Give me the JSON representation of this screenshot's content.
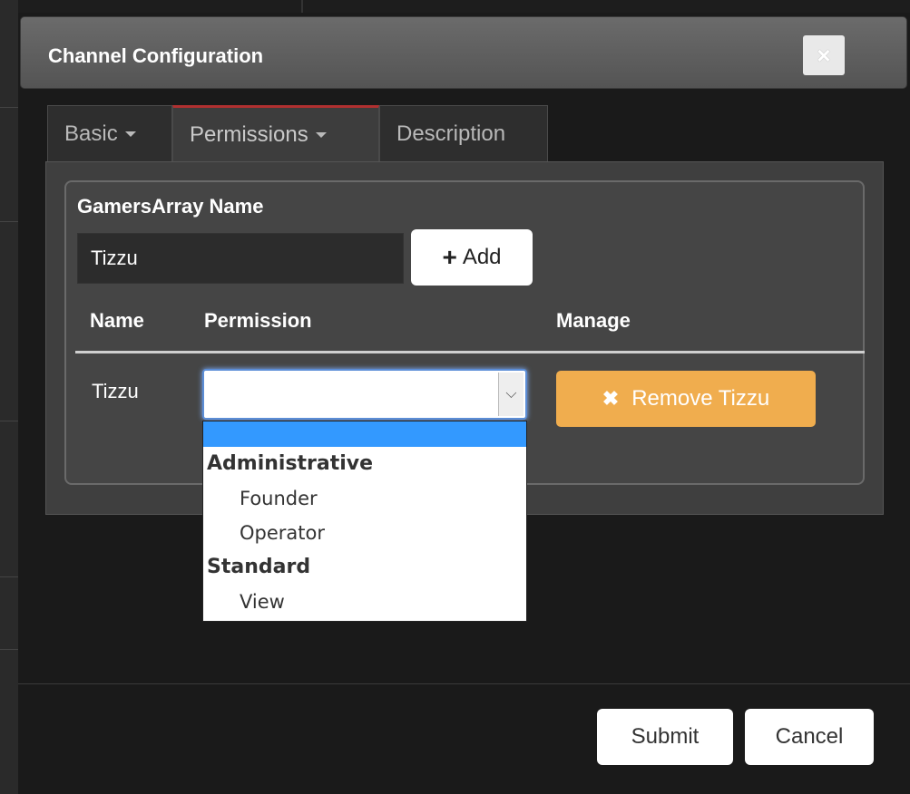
{
  "window": {
    "title": "Channel Configuration",
    "close_label": "×"
  },
  "tabs": [
    {
      "label": "Basic",
      "has_caret": true
    },
    {
      "label": "Permissions",
      "has_caret": true,
      "active": true
    },
    {
      "label": "Description",
      "has_caret": false
    }
  ],
  "panel": {
    "title": "GamersArray Name",
    "name_input_value": "Tizzu",
    "add_button": {
      "icon": "plus-icon",
      "label": "Add"
    },
    "table": {
      "headers": [
        "Name",
        "Permission",
        "Manage"
      ],
      "rows": [
        {
          "name": "Tizzu",
          "permission": "",
          "remove_label": "Remove Tizzu",
          "remove_icon": "close-icon"
        }
      ]
    }
  },
  "dropdown": {
    "groups": [
      {
        "label": "Administrative",
        "options": [
          "Founder",
          "Operator"
        ]
      },
      {
        "label": "Standard",
        "options": [
          "View"
        ]
      }
    ]
  },
  "footer": {
    "submit_label": "Submit",
    "cancel_label": "Cancel"
  },
  "colors": {
    "active_tab_accent": "#b03030",
    "remove_button": "#f0ad4e",
    "highlight": "#3399ff"
  }
}
